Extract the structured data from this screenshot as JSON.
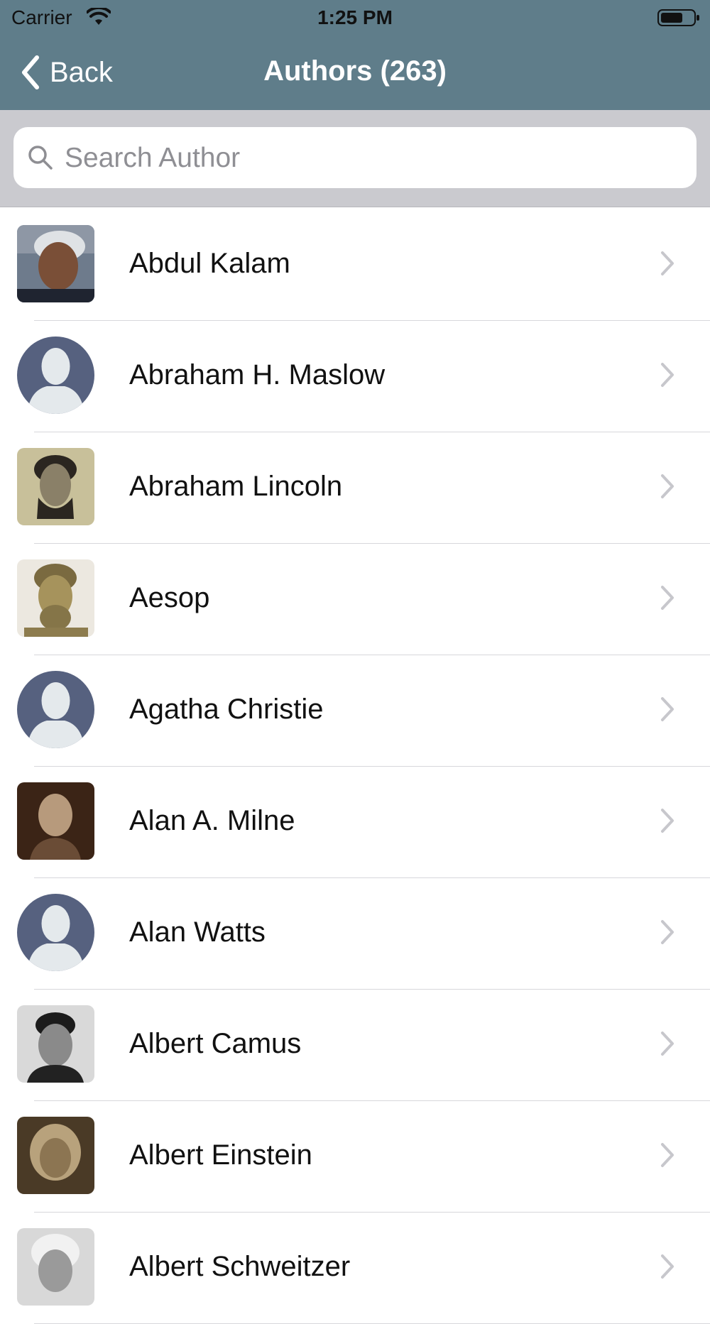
{
  "status_bar": {
    "carrier": "Carrier",
    "time": "1:25 PM"
  },
  "nav": {
    "back_label": "Back",
    "title": "Authors (263)"
  },
  "search": {
    "placeholder": "Search Author",
    "value": ""
  },
  "colors": {
    "nav_bar": "#5f7d8a",
    "search_bar": "#cacacf",
    "default_avatar": "#56617f"
  },
  "authors": [
    {
      "name": "Abdul Kalam",
      "avatar": "photo"
    },
    {
      "name": "Abraham H. Maslow",
      "avatar": "default-person-icon"
    },
    {
      "name": "Abraham Lincoln",
      "avatar": "photo"
    },
    {
      "name": "Aesop",
      "avatar": "photo"
    },
    {
      "name": "Agatha Christie",
      "avatar": "default-person-icon"
    },
    {
      "name": "Alan A. Milne",
      "avatar": "photo"
    },
    {
      "name": "Alan Watts",
      "avatar": "default-person-icon"
    },
    {
      "name": "Albert Camus",
      "avatar": "photo"
    },
    {
      "name": "Albert Einstein",
      "avatar": "photo"
    },
    {
      "name": "Albert Schweitzer",
      "avatar": "photo"
    }
  ]
}
